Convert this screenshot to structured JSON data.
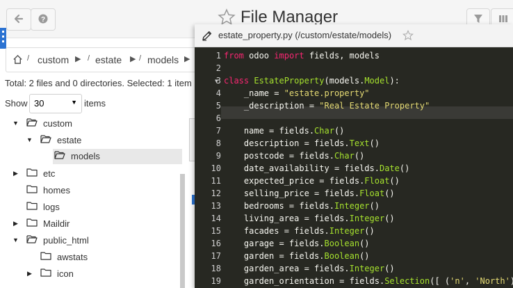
{
  "app": {
    "title": "File Manager",
    "colors": {
      "accent": "#2c73d2",
      "editor_bg": "#272822",
      "keyword": "#f92672",
      "class": "#a6e22e",
      "string": "#e6db74"
    }
  },
  "toolbar": {
    "back_icon": "arrow-left-icon",
    "help_icon": "question-icon",
    "favorite_icon": "star-icon",
    "filter_icon": "funnel-icon",
    "columns_icon": "columns-icon"
  },
  "breadcrumb": {
    "home_icon": "home-icon",
    "items": [
      "custom",
      "estate",
      "models"
    ]
  },
  "status": {
    "text": "Total: 2 files and 0 directories. Selected: 1 item"
  },
  "pager": {
    "show_label": "Show",
    "value": "30",
    "items_label": "items"
  },
  "tree": [
    {
      "name": "custom"
    },
    {
      "name": "estate"
    },
    {
      "name": "models"
    },
    {
      "name": "etc"
    },
    {
      "name": "homes"
    },
    {
      "name": "logs"
    },
    {
      "name": "Maildir"
    },
    {
      "name": "public_html"
    },
    {
      "name": "awstats"
    },
    {
      "name": "icon"
    }
  ],
  "editor": {
    "title": "estate_property.py (/custom/estate/models)",
    "edit_icon": "pencil-icon",
    "favorite_icon": "star-icon",
    "lines": [
      "from odoo import fields, models",
      "",
      "class EstateProperty(models.Model):",
      "    _name = \"estate.property\"",
      "    _description = \"Real Estate Property\"",
      "",
      "    name = fields.Char()",
      "    description = fields.Text()",
      "    postcode = fields.Char()",
      "    date_availability = fields.Date()",
      "    expected_price = fields.Float()",
      "    selling_price = fields.Float()",
      "    bedrooms = fields.Integer()",
      "    living_area = fields.Integer()",
      "    facades = fields.Integer()",
      "    garage = fields.Boolean()",
      "    garden = fields.Boolean()",
      "    garden_area = fields.Integer()",
      "    garden_orientation = fields.Selection([ ('n', 'North')"
    ]
  }
}
